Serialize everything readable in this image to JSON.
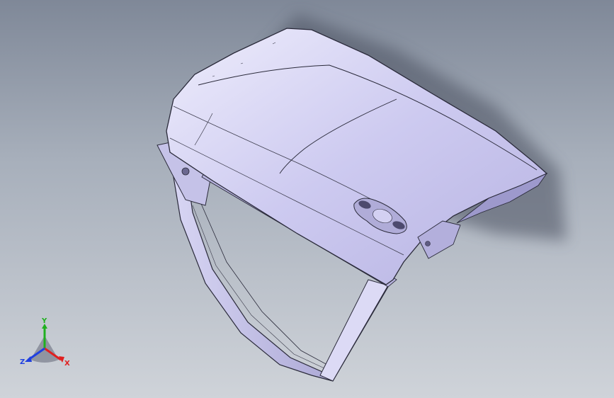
{
  "viewport": {
    "background_top": "#7f8898",
    "background_bottom": "#cfd3d9",
    "model": "car-door-panel"
  },
  "model_colors": {
    "surface": "#c9c6ee",
    "surface_light": "#e6e4fa",
    "surface_dark": "#8f8bc0",
    "edge": "#2a2a3a",
    "accent_red": "#c0392b"
  },
  "triad": {
    "x_label": "X",
    "y_label": "Y",
    "z_label": "Z",
    "x_color": "#e02020",
    "y_color": "#20b020",
    "z_color": "#2040e0"
  }
}
